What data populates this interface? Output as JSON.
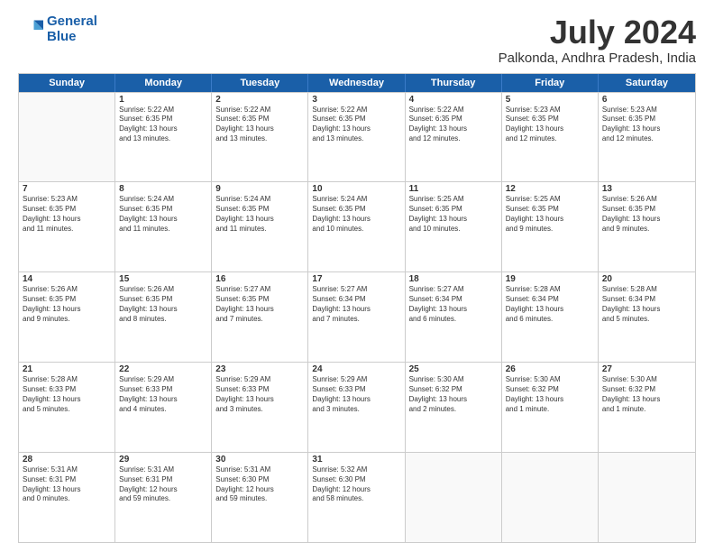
{
  "logo": {
    "line1": "General",
    "line2": "Blue"
  },
  "title": "July 2024",
  "subtitle": "Palkonda, Andhra Pradesh, India",
  "header_days": [
    "Sunday",
    "Monday",
    "Tuesday",
    "Wednesday",
    "Thursday",
    "Friday",
    "Saturday"
  ],
  "weeks": [
    [
      {
        "day": "",
        "lines": []
      },
      {
        "day": "1",
        "lines": [
          "Sunrise: 5:22 AM",
          "Sunset: 6:35 PM",
          "Daylight: 13 hours",
          "and 13 minutes."
        ]
      },
      {
        "day": "2",
        "lines": [
          "Sunrise: 5:22 AM",
          "Sunset: 6:35 PM",
          "Daylight: 13 hours",
          "and 13 minutes."
        ]
      },
      {
        "day": "3",
        "lines": [
          "Sunrise: 5:22 AM",
          "Sunset: 6:35 PM",
          "Daylight: 13 hours",
          "and 13 minutes."
        ]
      },
      {
        "day": "4",
        "lines": [
          "Sunrise: 5:22 AM",
          "Sunset: 6:35 PM",
          "Daylight: 13 hours",
          "and 12 minutes."
        ]
      },
      {
        "day": "5",
        "lines": [
          "Sunrise: 5:23 AM",
          "Sunset: 6:35 PM",
          "Daylight: 13 hours",
          "and 12 minutes."
        ]
      },
      {
        "day": "6",
        "lines": [
          "Sunrise: 5:23 AM",
          "Sunset: 6:35 PM",
          "Daylight: 13 hours",
          "and 12 minutes."
        ]
      }
    ],
    [
      {
        "day": "7",
        "lines": [
          "Sunrise: 5:23 AM",
          "Sunset: 6:35 PM",
          "Daylight: 13 hours",
          "and 11 minutes."
        ]
      },
      {
        "day": "8",
        "lines": [
          "Sunrise: 5:24 AM",
          "Sunset: 6:35 PM",
          "Daylight: 13 hours",
          "and 11 minutes."
        ]
      },
      {
        "day": "9",
        "lines": [
          "Sunrise: 5:24 AM",
          "Sunset: 6:35 PM",
          "Daylight: 13 hours",
          "and 11 minutes."
        ]
      },
      {
        "day": "10",
        "lines": [
          "Sunrise: 5:24 AM",
          "Sunset: 6:35 PM",
          "Daylight: 13 hours",
          "and 10 minutes."
        ]
      },
      {
        "day": "11",
        "lines": [
          "Sunrise: 5:25 AM",
          "Sunset: 6:35 PM",
          "Daylight: 13 hours",
          "and 10 minutes."
        ]
      },
      {
        "day": "12",
        "lines": [
          "Sunrise: 5:25 AM",
          "Sunset: 6:35 PM",
          "Daylight: 13 hours",
          "and 9 minutes."
        ]
      },
      {
        "day": "13",
        "lines": [
          "Sunrise: 5:26 AM",
          "Sunset: 6:35 PM",
          "Daylight: 13 hours",
          "and 9 minutes."
        ]
      }
    ],
    [
      {
        "day": "14",
        "lines": [
          "Sunrise: 5:26 AM",
          "Sunset: 6:35 PM",
          "Daylight: 13 hours",
          "and 9 minutes."
        ]
      },
      {
        "day": "15",
        "lines": [
          "Sunrise: 5:26 AM",
          "Sunset: 6:35 PM",
          "Daylight: 13 hours",
          "and 8 minutes."
        ]
      },
      {
        "day": "16",
        "lines": [
          "Sunrise: 5:27 AM",
          "Sunset: 6:35 PM",
          "Daylight: 13 hours",
          "and 7 minutes."
        ]
      },
      {
        "day": "17",
        "lines": [
          "Sunrise: 5:27 AM",
          "Sunset: 6:34 PM",
          "Daylight: 13 hours",
          "and 7 minutes."
        ]
      },
      {
        "day": "18",
        "lines": [
          "Sunrise: 5:27 AM",
          "Sunset: 6:34 PM",
          "Daylight: 13 hours",
          "and 6 minutes."
        ]
      },
      {
        "day": "19",
        "lines": [
          "Sunrise: 5:28 AM",
          "Sunset: 6:34 PM",
          "Daylight: 13 hours",
          "and 6 minutes."
        ]
      },
      {
        "day": "20",
        "lines": [
          "Sunrise: 5:28 AM",
          "Sunset: 6:34 PM",
          "Daylight: 13 hours",
          "and 5 minutes."
        ]
      }
    ],
    [
      {
        "day": "21",
        "lines": [
          "Sunrise: 5:28 AM",
          "Sunset: 6:33 PM",
          "Daylight: 13 hours",
          "and 5 minutes."
        ]
      },
      {
        "day": "22",
        "lines": [
          "Sunrise: 5:29 AM",
          "Sunset: 6:33 PM",
          "Daylight: 13 hours",
          "and 4 minutes."
        ]
      },
      {
        "day": "23",
        "lines": [
          "Sunrise: 5:29 AM",
          "Sunset: 6:33 PM",
          "Daylight: 13 hours",
          "and 3 minutes."
        ]
      },
      {
        "day": "24",
        "lines": [
          "Sunrise: 5:29 AM",
          "Sunset: 6:33 PM",
          "Daylight: 13 hours",
          "and 3 minutes."
        ]
      },
      {
        "day": "25",
        "lines": [
          "Sunrise: 5:30 AM",
          "Sunset: 6:32 PM",
          "Daylight: 13 hours",
          "and 2 minutes."
        ]
      },
      {
        "day": "26",
        "lines": [
          "Sunrise: 5:30 AM",
          "Sunset: 6:32 PM",
          "Daylight: 13 hours",
          "and 1 minute."
        ]
      },
      {
        "day": "27",
        "lines": [
          "Sunrise: 5:30 AM",
          "Sunset: 6:32 PM",
          "Daylight: 13 hours",
          "and 1 minute."
        ]
      }
    ],
    [
      {
        "day": "28",
        "lines": [
          "Sunrise: 5:31 AM",
          "Sunset: 6:31 PM",
          "Daylight: 13 hours",
          "and 0 minutes."
        ]
      },
      {
        "day": "29",
        "lines": [
          "Sunrise: 5:31 AM",
          "Sunset: 6:31 PM",
          "Daylight: 12 hours",
          "and 59 minutes."
        ]
      },
      {
        "day": "30",
        "lines": [
          "Sunrise: 5:31 AM",
          "Sunset: 6:30 PM",
          "Daylight: 12 hours",
          "and 59 minutes."
        ]
      },
      {
        "day": "31",
        "lines": [
          "Sunrise: 5:32 AM",
          "Sunset: 6:30 PM",
          "Daylight: 12 hours",
          "and 58 minutes."
        ]
      },
      {
        "day": "",
        "lines": []
      },
      {
        "day": "",
        "lines": []
      },
      {
        "day": "",
        "lines": []
      }
    ]
  ]
}
